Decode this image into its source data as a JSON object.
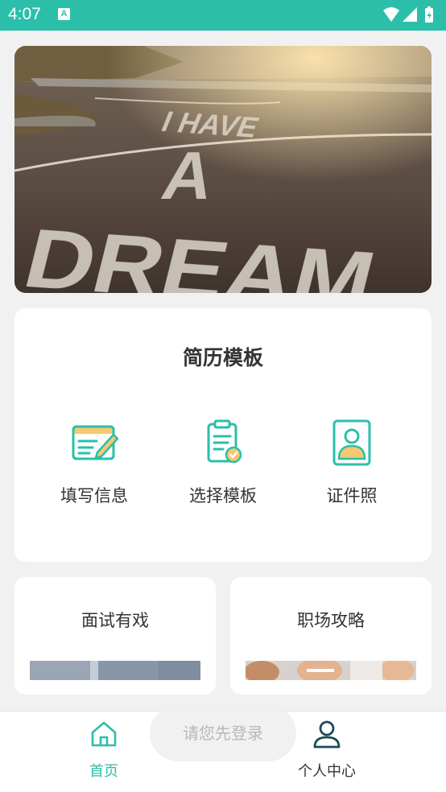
{
  "status_bar": {
    "time": "4:07",
    "notification_icon": "A",
    "icons": [
      "wifi-icon",
      "signal-icon",
      "battery-icon"
    ]
  },
  "banner": {
    "road_text": [
      "I HAVE",
      "A",
      "DREAM"
    ]
  },
  "resume_section": {
    "title": "简历模板",
    "features": [
      {
        "label": "填写信息",
        "icon": "edit-form-icon"
      },
      {
        "label": "选择模板",
        "icon": "clipboard-check-icon"
      },
      {
        "label": "证件照",
        "icon": "id-photo-icon"
      }
    ]
  },
  "cards": [
    {
      "title": "面试有戏"
    },
    {
      "title": "职场攻略"
    }
  ],
  "toast": "请您先登录",
  "bottom_nav": {
    "items": [
      {
        "label": "首页",
        "icon": "home-icon",
        "active": true
      },
      {
        "label": "个人中心",
        "icon": "person-icon",
        "active": false
      }
    ]
  },
  "colors": {
    "accent": "#2bbfaa",
    "status_bar": "#2bbfaa",
    "background": "#f1f1f1",
    "icon_yellow": "#f7c872"
  }
}
